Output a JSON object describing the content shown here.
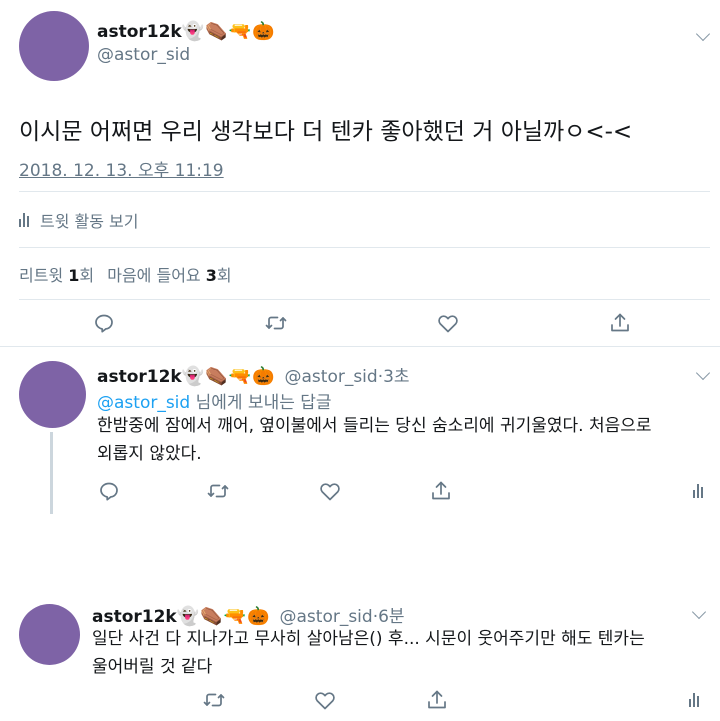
{
  "main_tweet": {
    "display_name": "astor12k",
    "emojis": "👻⚰️🔫🎃",
    "handle": "@astor_sid",
    "text": "이시문 어쩌면 우리 생각보다 더 텐카 좋아했던 거 아닐까ㅇ<-<",
    "timestamp": "2018. 12. 13. 오후 11:19",
    "activity_label": "트윗 활동 보기",
    "retweet_label": "리트윗",
    "retweet_count": "1",
    "retweet_unit": "회",
    "like_label": "마음에 들어요",
    "like_count": "3",
    "like_unit": "회"
  },
  "replies": [
    {
      "display_name": "astor12k",
      "emojis": "👻⚰️🔫🎃",
      "handle": "@astor_sid",
      "time": "3초",
      "reply_to_handle": "@astor_sid",
      "reply_to_suffix": " 님에게 보내는 답글",
      "text_line1": "한밤중에 잠에서 깨어, 옆이불에서 들리는 당신 숨소리에 귀기울였다. 처음으로",
      "text_line2": "외롭지 않았다."
    },
    {
      "display_name": "astor12k",
      "emojis": "👻⚰️🔫🎃",
      "handle": "@astor_sid",
      "time": "6분",
      "text_line1": "일단 사건 다 지나가고 무사히 살아남은() 후... 시문이 웃어주기만 해도 텐카는",
      "text_line2": "울어버릴 것 같다"
    }
  ],
  "separator": "·",
  "colors": {
    "avatar": "#7e63a6",
    "link": "#1da1f2",
    "secondary_text": "#657786",
    "divider": "#e1e8ed",
    "thread_line": "#ccd6dd"
  }
}
